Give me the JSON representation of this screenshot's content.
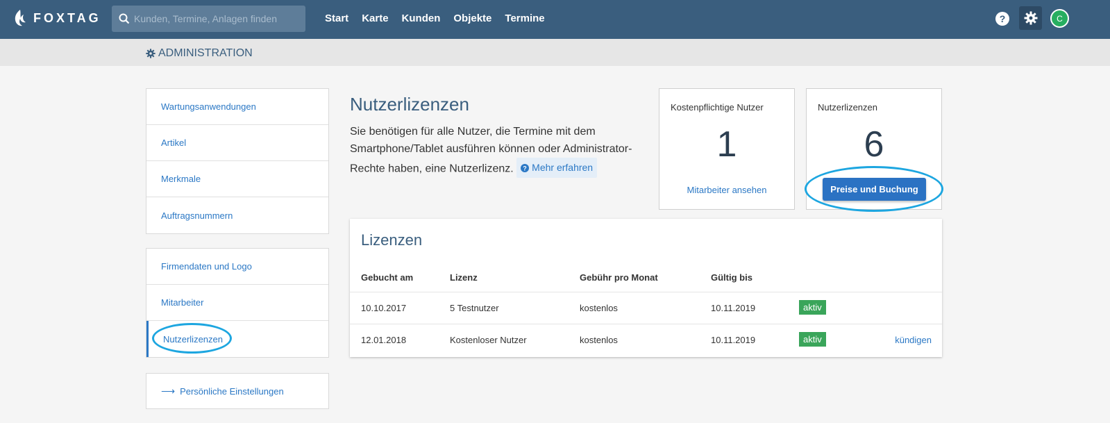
{
  "brand": {
    "name": "FOXTAG"
  },
  "search": {
    "placeholder": "Kunden, Termine, Anlagen finden"
  },
  "nav": [
    "Start",
    "Karte",
    "Kunden",
    "Objekte",
    "Termine"
  ],
  "user": {
    "initial": "C"
  },
  "admin": {
    "title": "ADMINISTRATION"
  },
  "sidebar": {
    "group1": [
      "Wartungsanwendungen",
      "Artikel",
      "Merkmale",
      "Auftragsnummern"
    ],
    "group2": [
      "Firmendaten und Logo",
      "Mitarbeiter",
      "Nutzerlizenzen"
    ],
    "active": "Nutzerlizenzen",
    "settings_link": "Persönliche Einstellungen"
  },
  "main": {
    "title": "Nutzerlizenzen",
    "description": "Sie benötigen für alle Nutzer, die Termine mit dem Smartphone/Tablet ausführen können oder Administrator-Rechte haben, eine Nutzerlizenz.",
    "more_link": "Mehr erfahren"
  },
  "cards": {
    "paid_users": {
      "label": "Kostenpflichtige Nutzer",
      "value": "1",
      "link": "Mitarbeiter ansehen"
    },
    "licenses": {
      "label": "Nutzerlizenzen",
      "value": "6",
      "button": "Preise und Buchung"
    }
  },
  "licenses_table": {
    "title": "Lizenzen",
    "columns": [
      "Gebucht am",
      "Lizenz",
      "Gebühr pro Monat",
      "Gültig bis"
    ],
    "rows": [
      {
        "booked": "10.10.2017",
        "license": "5 Testnutzer",
        "fee": "kostenlos",
        "valid_until": "10.11.2019",
        "status": "aktiv",
        "action": ""
      },
      {
        "booked": "12.01.2018",
        "license": "Kostenloser Nutzer",
        "fee": "kostenlos",
        "valid_until": "10.11.2019",
        "status": "aktiv",
        "action": "kündigen"
      }
    ]
  },
  "colors": {
    "header": "#3a5e7e",
    "link": "#2b78c5",
    "badge": "#3aa55a",
    "highlight": "#1da6e0",
    "avatar": "#27ae60"
  }
}
